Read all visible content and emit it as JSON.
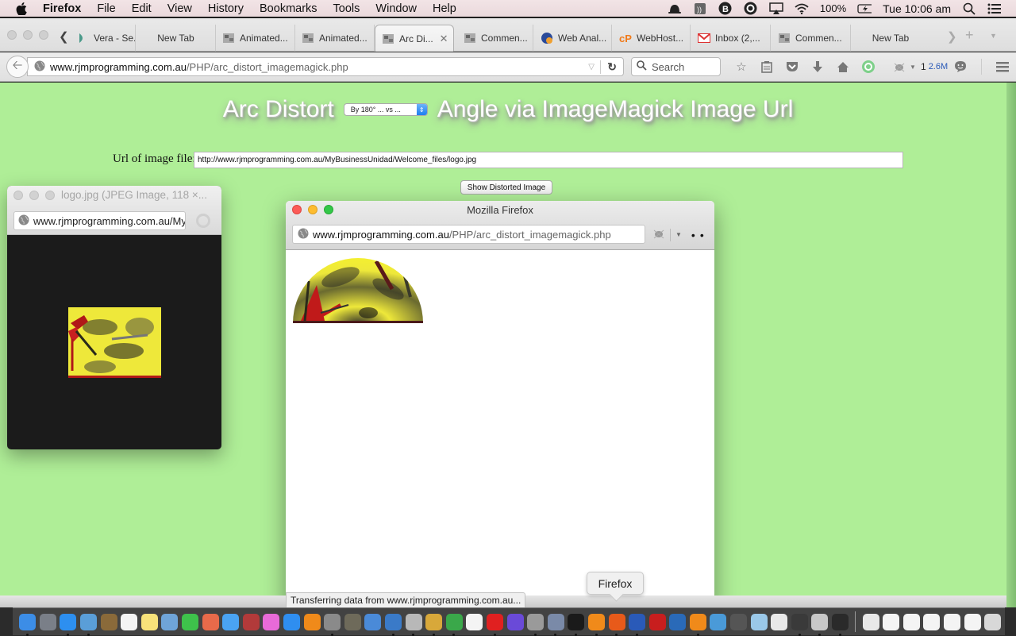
{
  "menubar": {
    "app": "Firefox",
    "items": [
      "File",
      "Edit",
      "View",
      "History",
      "Bookmarks",
      "Tools",
      "Window",
      "Help"
    ],
    "battery": "100%",
    "clock": "Tue 10:06 am",
    "status_icons": [
      "alfred-hat-icon",
      "audio-hijack-icon",
      "bbedit-icon",
      "opera-icon",
      "airplay-icon",
      "wifi-icon",
      "battery-charging-icon",
      "spotlight-icon",
      "notification-center-icon"
    ]
  },
  "tabs": [
    {
      "label": "Vera - Se...",
      "icon": "vera-icon"
    },
    {
      "label": "New Tab",
      "icon": ""
    },
    {
      "label": "Animated...",
      "icon": "page-thumb-icon"
    },
    {
      "label": "Animated...",
      "icon": "page-thumb-icon"
    },
    {
      "label": "Arc Di...",
      "icon": "page-thumb-icon",
      "active": true
    },
    {
      "label": "Commen...",
      "icon": "page-thumb-icon"
    },
    {
      "label": "Web Anal...",
      "icon": "web-analytics-icon"
    },
    {
      "label": "WebHost...",
      "icon": "cpanel-icon"
    },
    {
      "label": "Inbox (2,...",
      "icon": "gmail-icon"
    },
    {
      "label": "Commen...",
      "icon": "page-thumb-icon"
    },
    {
      "label": "New Tab",
      "icon": ""
    }
  ],
  "navbar": {
    "url_domain": "www.rjmprogramming.com.au",
    "url_path": "/PHP/arc_distort_imagemagick.php",
    "search_placeholder": "Search",
    "badge_count": "1",
    "badge_size": "2.6M"
  },
  "page": {
    "title_before": "Arc Distort",
    "angle_select_value": "By 180° ... vs ...",
    "title_after": "Angle via ImageMagick Image Url",
    "url_label": "Url of image file:",
    "url_value": "http://www.rjmprogramming.com.au/MyBusinessUnidad/Welcome_files/logo.jpg",
    "show_button": "Show Distorted Image",
    "bg_color": "#afee97"
  },
  "image_window": {
    "title": "logo.jpg (JPEG Image, 118 ×...",
    "url": "www.rjmprogramming.com.au/MyBusinessUnidad/Welcome_files/logo.jpg"
  },
  "popup_window": {
    "title": "Mozilla Firefox",
    "url_domain": "www.rjmprogramming.com.au",
    "url_path": "/PHP/arc_distort_imagemagick.php"
  },
  "status_text": "Transferring data from www.rjmprogramming.com.au...",
  "dock_tooltip": "Firefox",
  "dock": [
    {
      "name": "finder",
      "color": "#3c8de6",
      "running": true
    },
    {
      "name": "launchpad",
      "color": "#7a7f88",
      "running": false
    },
    {
      "name": "safari",
      "color": "#2d8ff0",
      "running": true
    },
    {
      "name": "mail",
      "color": "#5a9ed8",
      "running": true
    },
    {
      "name": "contacts",
      "color": "#8a6a3a",
      "running": false
    },
    {
      "name": "calendar",
      "color": "#f4f4f4",
      "running": false
    },
    {
      "name": "notes",
      "color": "#f7e27a",
      "running": false
    },
    {
      "name": "preview",
      "color": "#6fa4d8",
      "running": false
    },
    {
      "name": "facetime",
      "color": "#3ec24b",
      "running": false
    },
    {
      "name": "photos",
      "color": "#e86a4a",
      "running": false
    },
    {
      "name": "messages",
      "color": "#4aa3f2",
      "running": false
    },
    {
      "name": "photo-booth",
      "color": "#b23a3a",
      "running": false
    },
    {
      "name": "itunes",
      "color": "#e86ad8",
      "running": false
    },
    {
      "name": "app-store",
      "color": "#2f8ef0",
      "running": false
    },
    {
      "name": "ibooks",
      "color": "#f08a1a",
      "running": false
    },
    {
      "name": "system-preferences",
      "color": "#8a8a8a",
      "running": true
    },
    {
      "name": "gimp",
      "color": "#6e6a5a",
      "running": false
    },
    {
      "name": "xcode",
      "color": "#4a8ad8",
      "running": false
    },
    {
      "name": "wamp",
      "color": "#3a7ac8",
      "running": true
    },
    {
      "name": "disk-utility",
      "color": "#b8b8b8",
      "running": true
    },
    {
      "name": "sketchbook",
      "color": "#d8a83a",
      "running": true
    },
    {
      "name": "chrome",
      "color": "#3aa84a",
      "running": true
    },
    {
      "name": "textedit",
      "color": "#f4f4f4",
      "running": false
    },
    {
      "name": "opera",
      "color": "#e02020",
      "running": true
    },
    {
      "name": "imovie",
      "color": "#6a4ad8",
      "running": false
    },
    {
      "name": "automator",
      "color": "#9a9a9a",
      "running": true
    },
    {
      "name": "image-capture",
      "color": "#7a8aa8",
      "running": true
    },
    {
      "name": "terminal",
      "color": "#1a1a1a",
      "running": true
    },
    {
      "name": "avast",
      "color": "#f08a1a",
      "running": true
    },
    {
      "name": "firefox",
      "color": "#e85a1a",
      "running": true
    },
    {
      "name": "bbedit",
      "color": "#2a5ab8",
      "running": true
    },
    {
      "name": "filezilla",
      "color": "#c81e1e",
      "running": false
    },
    {
      "name": "quicktime",
      "color": "#2a6ab8",
      "running": false
    },
    {
      "name": "vlc",
      "color": "#f08a1a",
      "running": true
    },
    {
      "name": "remote-desktop",
      "color": "#4a9ad8",
      "running": false
    },
    {
      "name": "help",
      "color": "#555555",
      "running": false
    },
    {
      "name": "virtualbox",
      "color": "#9ac8e8",
      "running": false
    },
    {
      "name": "script-editor",
      "color": "#e8e8e8",
      "running": false
    },
    {
      "name": "printer",
      "color": "#3a3a3a",
      "running": true
    },
    {
      "name": "dvd-player",
      "color": "#c8c8c8",
      "running": true
    },
    {
      "name": "gyroflow",
      "color": "#2a2a2a",
      "running": true
    }
  ],
  "dock_right": [
    {
      "name": "downloads-stack",
      "color": "#e8e8e8"
    },
    {
      "name": "minimized-window-1",
      "color": "#f4f4f4"
    },
    {
      "name": "minimized-window-2",
      "color": "#f4f4f4"
    },
    {
      "name": "minimized-window-3",
      "color": "#f4f4f4"
    },
    {
      "name": "minimized-window-4",
      "color": "#f4f4f4"
    },
    {
      "name": "minimized-window-5",
      "color": "#f4f4f4"
    },
    {
      "name": "trash",
      "color": "#d8d8d8"
    }
  ]
}
